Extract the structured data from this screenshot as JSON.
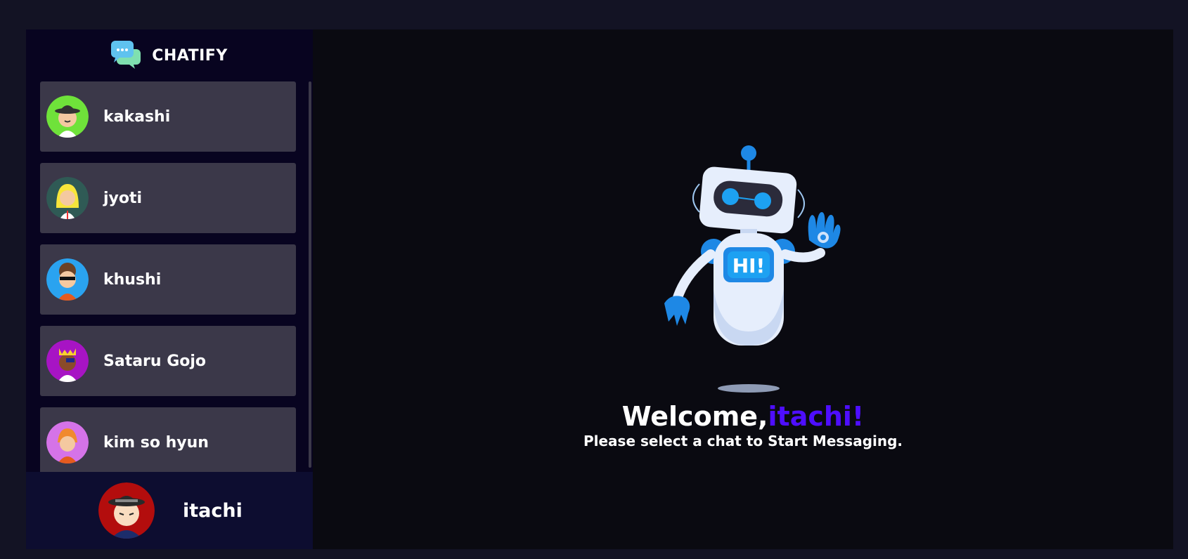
{
  "brand": {
    "name": "CHATIFY",
    "icon": "chat-bubbles-icon"
  },
  "contacts": [
    {
      "name": "kakashi",
      "avatar_bg": "#6fe23a"
    },
    {
      "name": "jyoti",
      "avatar_bg": "#2f5a55"
    },
    {
      "name": "khushi",
      "avatar_bg": "#2aa3f0"
    },
    {
      "name": "Sataru Gojo",
      "avatar_bg": "#a714c4"
    },
    {
      "name": "kim so hyun",
      "avatar_bg": "#d573e8"
    }
  ],
  "current_user": {
    "name": "itachi",
    "avatar_bg": "#b30d0d"
  },
  "welcome": {
    "greeting": "Welcome,",
    "username": "itachi!",
    "subtitle": "Please select a chat to Start Messaging."
  },
  "colors": {
    "accent": "#4e0eff",
    "card": "#3b3849",
    "sidebar": "#080420"
  }
}
